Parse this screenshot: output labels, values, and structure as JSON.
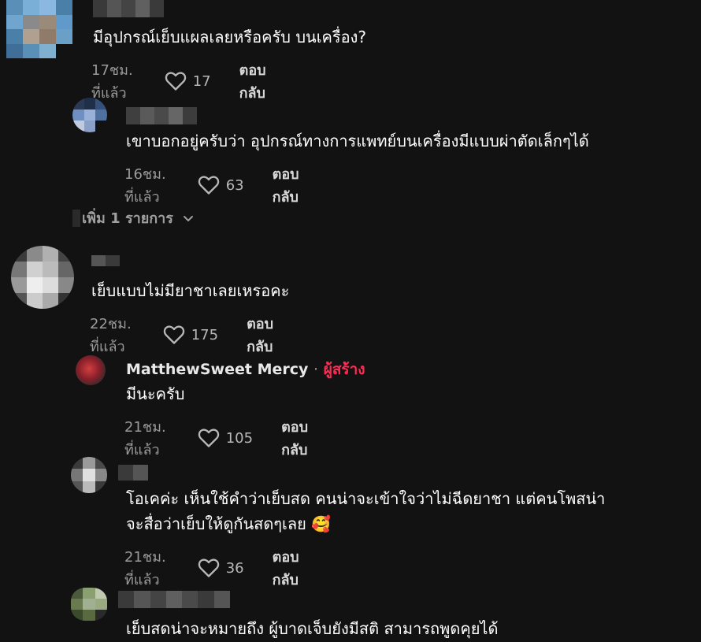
{
  "comments": [
    {
      "text": "มีอุปกรณ์เย็บแผลเลยหรือครับ บนเครื่อง?",
      "time": "17ชม. ที่แล้ว",
      "likes": "17",
      "reply": "ตอบกลับ"
    },
    {
      "text": "เขาบอกอยู่ครับว่า อุปกรณ์ทางการแพทย์บนเครื่องมีแบบผ่าตัดเล็กๆได้",
      "time": "16ชม. ที่แล้ว",
      "likes": "63",
      "reply": "ตอบกลับ"
    },
    {
      "text": "เย็บแบบไม่มียาชาเลยเหรอคะ",
      "time": "22ชม. ที่แล้ว",
      "likes": "175",
      "reply": "ตอบกลับ"
    },
    {
      "author": "MatthewSweet Mercy",
      "separator": "·",
      "badge": "ผู้สร้าง",
      "text": "มีนะครับ",
      "time": "21ชม. ที่แล้ว",
      "likes": "105",
      "reply": "ตอบกลับ"
    },
    {
      "text_line1": "โอเคค่ะ เห็นใช้คำว่าเย็บสด คนน่าจะเข้าใจว่าไม่ฉีดยาชา แต่คนโพสน่า",
      "text_line2": "จะสื่อว่าเย็บให้ดูกันสดๆเลย 🥰",
      "time": "21ชม. ที่แล้ว",
      "likes": "36",
      "reply": "ตอบกลับ"
    },
    {
      "text": "เย็บสดน่าจะหมายถึง ผู้บาดเจ็บยังมีสติ สามารถพูดคุยได้"
    }
  ],
  "view_more": "เพิ่ม 1 รายการ",
  "colors": {
    "background": "#121212",
    "creator_badge": "#fe2c55",
    "meta_text": "#9a9a9a"
  },
  "icons": {
    "like": "heart-outline-icon",
    "expand": "chevron-down-icon"
  }
}
